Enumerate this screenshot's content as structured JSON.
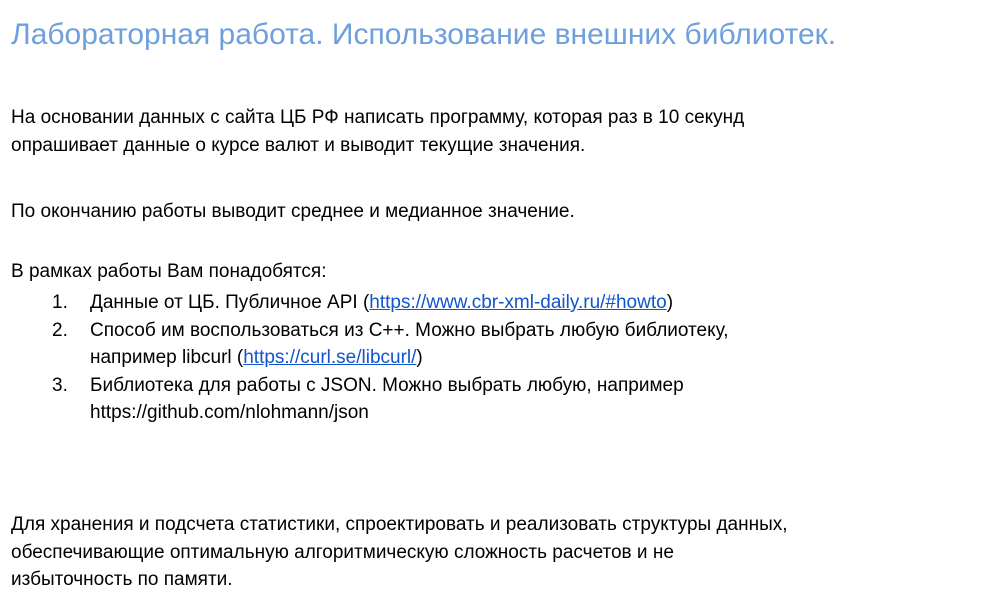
{
  "title": "Лабораторная работа. Использование внешних библиотек.",
  "paragraph1": {
    "line1": "На основании данных с сайта ЦБ РФ написать программу, которая раз в 10 секунд",
    "line2": "опрашивает данные о курсе валют и выводит текущие значения."
  },
  "paragraph2": "По окончанию работы выводит среднее и медианное значение.",
  "paragraph3": "В рамках работы Вам понадобятся:",
  "list": [
    {
      "num": "1.",
      "text_before": "Данные от ЦБ. Публичное API (",
      "link": "https://www.cbr-xml-daily.ru/#howto",
      "text_after": ")"
    },
    {
      "num": "2.",
      "line1": "Способ им воспользоваться из С++. Можно выбрать любую библиотеку,",
      "text_before": "например libcurl (",
      "link": "https://curl.se/libcurl/",
      "text_after": ")"
    },
    {
      "num": "3.",
      "line1": "Библиотека для работы с JSON. Можно выбрать любую, например",
      "line2": "https://github.com/nlohmann/json"
    }
  ],
  "paragraph4": {
    "line1": "Для хранения и подсчета статистики, спроектировать и реализовать структуры данных,",
    "line2": "обеспечивающие оптимальную алгоритмическую сложность расчетов и не",
    "line3": "избыточность по памяти."
  },
  "colors": {
    "title": "#6fa0dc",
    "link": "#1155cc",
    "text": "#000000"
  }
}
